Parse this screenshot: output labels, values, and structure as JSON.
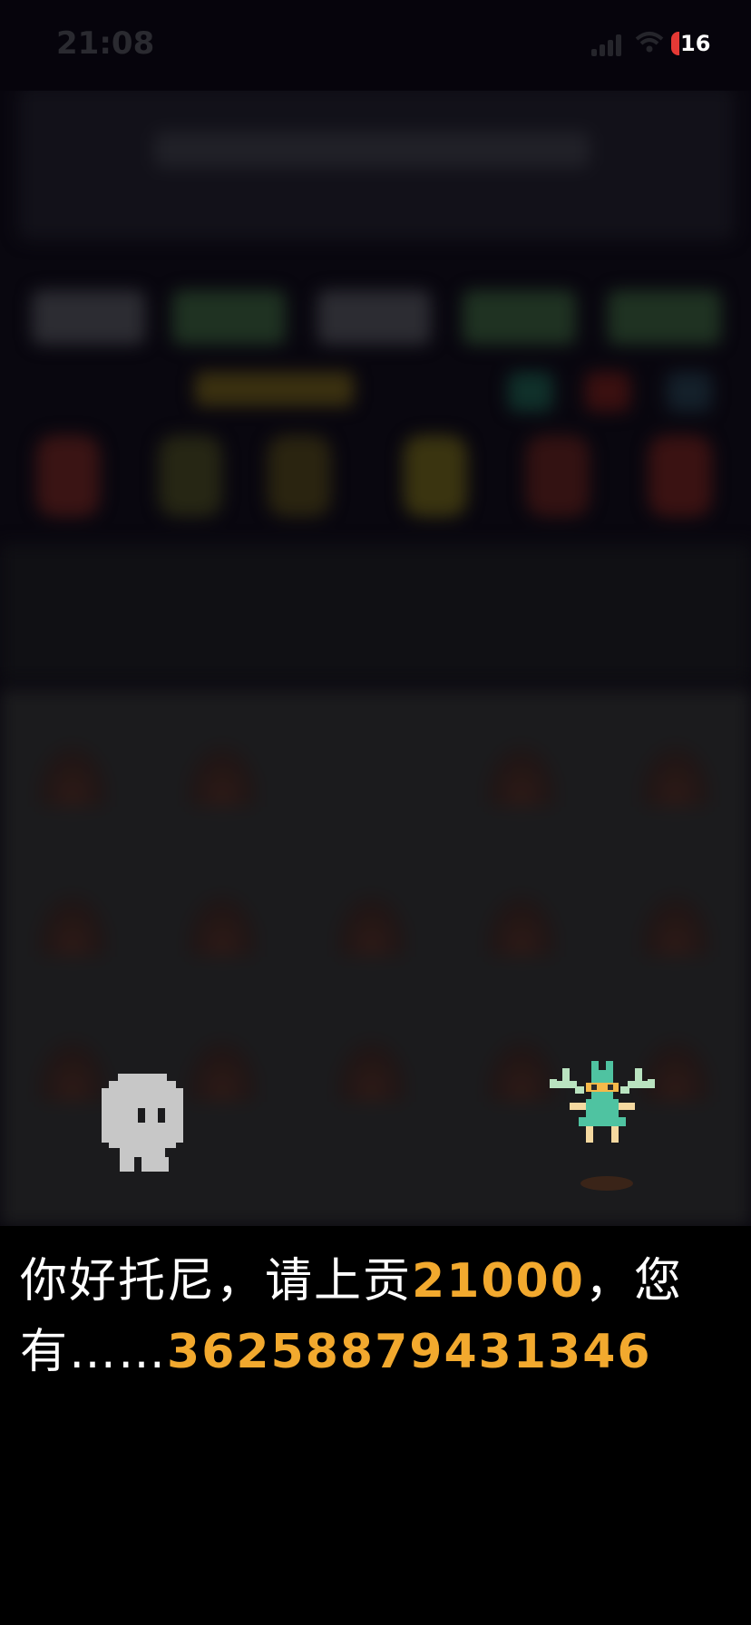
{
  "status_bar": {
    "time": "21:08",
    "battery_level": "16",
    "battery_color": "#e53935"
  },
  "dialog": {
    "line1_prefix": "你好托尼，请上贡",
    "tribute_amount": "21000",
    "line1_suffix": "，您",
    "line2_prefix": "有……",
    "owned_amount": "3625887943134​6",
    "highlight_color": "#f2a92e"
  },
  "sprites": {
    "player": "ghost-character",
    "npc": "green-fairy-character"
  }
}
